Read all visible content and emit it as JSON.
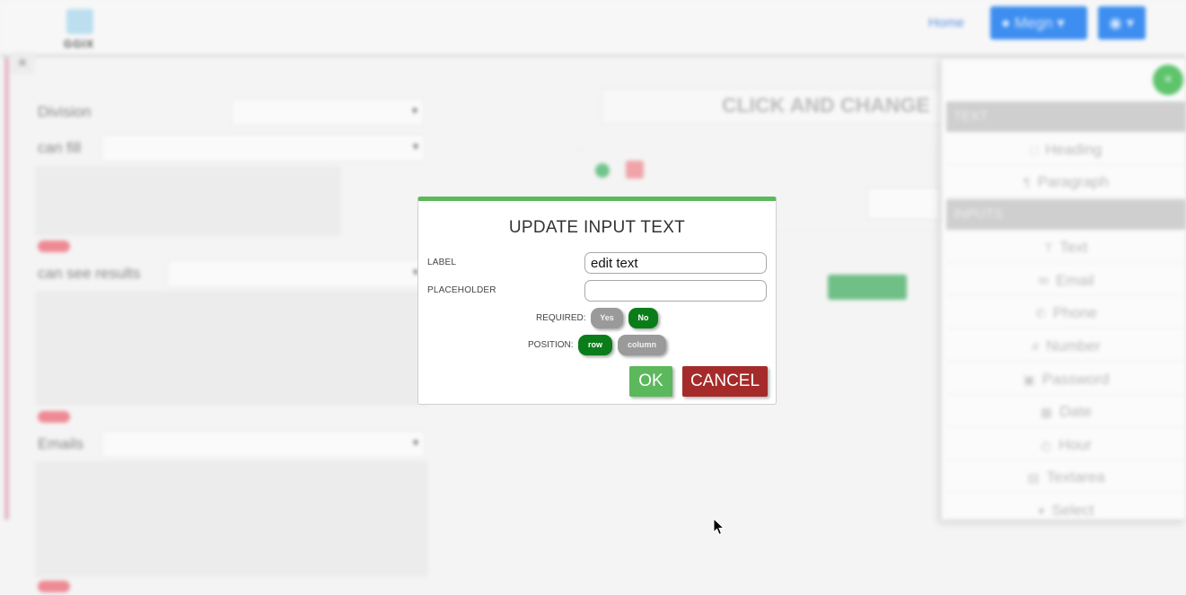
{
  "background": {
    "logo_text": "GGIX",
    "nav": {
      "home_label": "Home",
      "user_button_label": "Megn",
      "lang_button_label": "▾"
    },
    "menu_icon": "hamburger-icon",
    "form": {
      "division_label": "Division",
      "can_fill_label": "can fill",
      "can_see_results_label": "can see results",
      "emails_label": "Emails"
    },
    "canvas": {
      "title_placeholder": "CLICK AND CHANGE"
    },
    "sidebar": {
      "sections": [
        {
          "title": "TEXT",
          "items": [
            {
              "label": "Heading",
              "icon": "heading-icon"
            },
            {
              "label": "Paragraph",
              "icon": "paragraph-icon"
            }
          ]
        },
        {
          "title": "INPUTS",
          "items": [
            {
              "label": "Text",
              "icon": "text-icon"
            },
            {
              "label": "Email",
              "icon": "email-icon"
            },
            {
              "label": "Phone",
              "icon": "phone-icon"
            },
            {
              "label": "Number",
              "icon": "number-icon"
            },
            {
              "label": "Password",
              "icon": "password-icon"
            },
            {
              "label": "Date",
              "icon": "date-icon"
            },
            {
              "label": "Hour",
              "icon": "hour-icon"
            },
            {
              "label": "Textarea",
              "icon": "textarea-icon"
            },
            {
              "label": "Select",
              "icon": "select-icon"
            }
          ]
        }
      ]
    }
  },
  "modal": {
    "title": "UPDATE INPUT TEXT",
    "label_field": {
      "label": "LABEL",
      "value": "edit text"
    },
    "placeholder_field": {
      "label": "PLACEHOLDER",
      "value": ""
    },
    "required": {
      "label": "REQUIRED:",
      "options": [
        "Yes",
        "No"
      ],
      "selected": "No"
    },
    "position": {
      "label": "POSITION:",
      "options": [
        "row",
        "column"
      ],
      "selected": "row"
    },
    "ok_label": "OK",
    "cancel_label": "CANCEL",
    "accent_color": "#5cb85c",
    "selected_color": "#0a7d1a",
    "cancel_color": "#a52b2b"
  }
}
